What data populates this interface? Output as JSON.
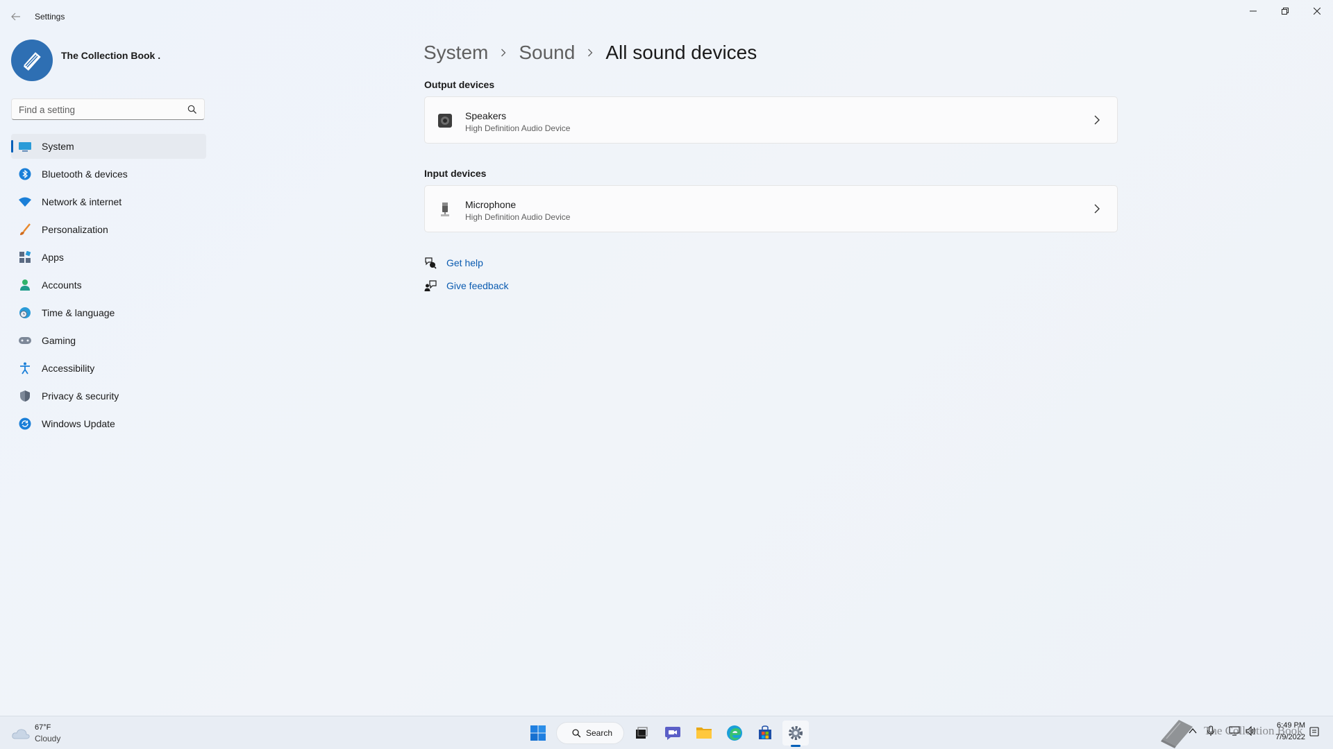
{
  "window": {
    "app_title": "Settings",
    "back_icon": "back-arrow-icon",
    "controls": {
      "minimize_icon": "minimize-icon",
      "restore_icon": "restore-icon",
      "close_icon": "close-icon"
    }
  },
  "profile": {
    "name": "The Collection Book .",
    "avatar_icon": "book-logo-icon"
  },
  "search": {
    "placeholder": "Find a setting",
    "value": "",
    "icon": "search-icon"
  },
  "sidebar": {
    "items": [
      {
        "label": "System",
        "icon": "system-icon",
        "active": true
      },
      {
        "label": "Bluetooth & devices",
        "icon": "bluetooth-icon"
      },
      {
        "label": "Network & internet",
        "icon": "wifi-icon"
      },
      {
        "label": "Personalization",
        "icon": "brush-icon"
      },
      {
        "label": "Apps",
        "icon": "apps-icon"
      },
      {
        "label": "Accounts",
        "icon": "account-icon"
      },
      {
        "label": "Time & language",
        "icon": "globe-clock-icon"
      },
      {
        "label": "Gaming",
        "icon": "gamepad-icon"
      },
      {
        "label": "Accessibility",
        "icon": "accessibility-icon"
      },
      {
        "label": "Privacy & security",
        "icon": "shield-icon"
      },
      {
        "label": "Windows Update",
        "icon": "update-icon"
      }
    ]
  },
  "breadcrumb": {
    "items": [
      "System",
      "Sound"
    ],
    "current": "All sound devices"
  },
  "output_section": {
    "title": "Output devices",
    "devices": [
      {
        "name": "Speakers",
        "description": "High Definition Audio Device",
        "icon": "speaker-icon"
      }
    ]
  },
  "input_section": {
    "title": "Input devices",
    "devices": [
      {
        "name": "Microphone",
        "description": "High Definition Audio Device",
        "icon": "microphone-icon"
      }
    ]
  },
  "links": [
    {
      "label": "Get help",
      "icon": "help-icon"
    },
    {
      "label": "Give feedback",
      "icon": "feedback-icon"
    }
  ],
  "taskbar": {
    "weather": {
      "temp": "67°F",
      "condition": "Cloudy",
      "icon": "cloud-icon"
    },
    "search_label": "Search",
    "apps": [
      "start-icon",
      "task-view-icon",
      "chat-icon",
      "file-explorer-icon",
      "edge-icon",
      "store-icon",
      "settings-icon"
    ],
    "tray": {
      "time": "6:49 PM",
      "date": "7/9/2022"
    },
    "watermark": "The Collection Book"
  },
  "colors": {
    "accent": "#005fb8",
    "link": "#0a5bb0",
    "avatar": "#2e6fb3"
  }
}
